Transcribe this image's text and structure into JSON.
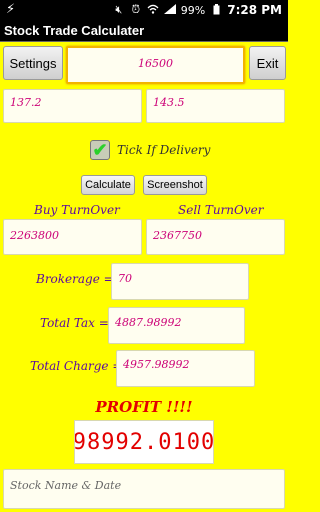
{
  "status_bar": {
    "battery": "99%",
    "time": "7:28 PM",
    "icons": [
      "lightning-icon",
      "silent-icon",
      "alarm-icon",
      "wifi-icon",
      "signal-icon",
      "battery-icon"
    ]
  },
  "app": {
    "title": "Stock Trade Calculater"
  },
  "toolbar": {
    "settings_label": "Settings",
    "quantity_value": "16500",
    "exit_label": "Exit"
  },
  "prices": {
    "buy_price": "137.2",
    "sell_price": "143.5"
  },
  "delivery": {
    "label": "Tick If Delivery",
    "checked": true
  },
  "actions": {
    "calculate_label": "Calculate",
    "screenshot_label": "Screenshot"
  },
  "turnover": {
    "buy_label": "Buy TurnOver",
    "buy_value": "2263800",
    "sell_label": "Sell TurnOver",
    "sell_value": "2367750"
  },
  "charges": {
    "brokerage_label": "Brokerage =",
    "brokerage_value": "70",
    "total_tax_label": "Total Tax =",
    "total_tax_value": "4887.98992",
    "total_charge_label": "Total Charge =",
    "total_charge_value": "4957.98992"
  },
  "result": {
    "profit_label": "PROFIT !!!!",
    "profit_value": "98992.0100"
  },
  "notes": {
    "placeholder": "Stock Name & Date"
  },
  "colors": {
    "background": "#ffff00",
    "field_text": "#cc0077",
    "label_text": "#5a0aa0",
    "profit_red": "#e20000",
    "check_green": "#2bd12b"
  }
}
